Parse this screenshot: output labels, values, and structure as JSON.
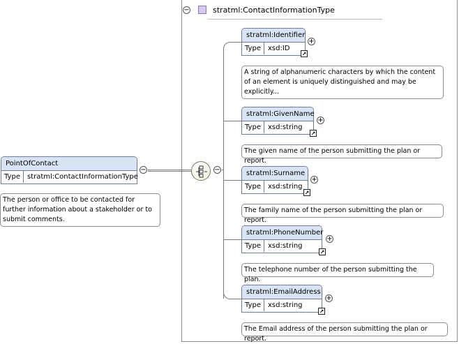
{
  "type": {
    "name": "stratml:ContactInformationType"
  },
  "root": {
    "name": "PointOfContact",
    "type_label": "Type",
    "type_value": "stratml:ContactInformationType",
    "doc": "The person or office to be contacted for further information about a stakeholder or to submit comments."
  },
  "elements": [
    {
      "name": "stratml:Identifier",
      "type_label": "Type",
      "type_value": "xsd:ID",
      "doc": "A string of alphanumeric characters by which the content of an element is uniquely distinguished and may be explicitly..."
    },
    {
      "name": "stratml:GivenName",
      "type_label": "Type",
      "type_value": "xsd:string",
      "doc": "The given name of the person submitting the plan or report."
    },
    {
      "name": "stratml:Surname",
      "type_label": "Type",
      "type_value": "xsd:string",
      "doc": "The family name of the person submitting the plan or report."
    },
    {
      "name": "stratml:PhoneNumber",
      "type_label": "Type",
      "type_value": "xsd:string",
      "doc": "The telephone number of the person submitting the plan."
    },
    {
      "name": "stratml:EmailAddress",
      "type_label": "Type",
      "type_value": "xsd:string",
      "doc": "The Email address of the person submitting the plan or report."
    }
  ],
  "icons": {
    "collapse": "minus-circle-icon",
    "expand": "plus-circle-icon",
    "navigate": "arrow-up-right-icon",
    "sequence": "sequence-compositor-icon"
  }
}
